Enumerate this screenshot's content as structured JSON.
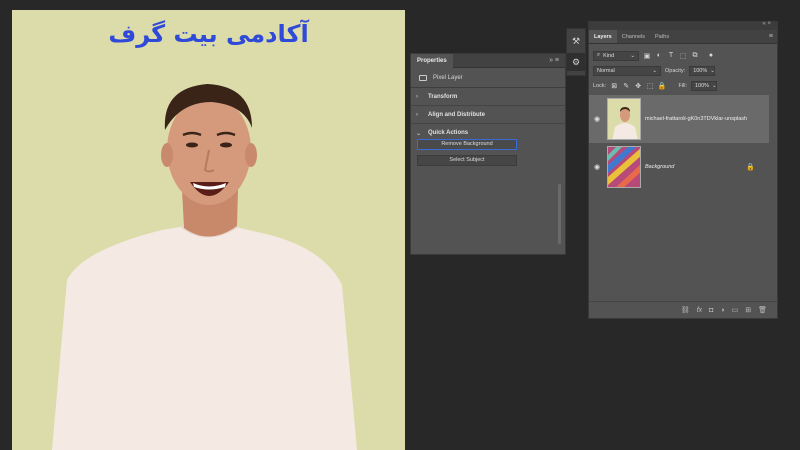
{
  "canvas": {
    "brand_text": "آکادمی بیت گرف"
  },
  "tools": {
    "items": [
      {
        "icon": "history-brush-icon",
        "glyph": "⚒"
      },
      {
        "icon": "properties-icon",
        "glyph": "⚙"
      }
    ]
  },
  "properties": {
    "tab_label": "Properties",
    "controls": "» ≡",
    "layer_type": "Pixel Layer",
    "sections": {
      "transform": "Transform",
      "align": "Align and Distribute",
      "quick_actions": "Quick Actions"
    },
    "buttons": {
      "remove_bg": "Remove Background",
      "select_subject": "Select Subject"
    }
  },
  "layers": {
    "tabs": [
      "Layers",
      "Channels",
      "Paths"
    ],
    "window_controls": "« ×",
    "filter": {
      "label": "Kind",
      "icons": [
        "image-filter-icon",
        "adjustment-filter-icon",
        "type-filter-icon",
        "shape-filter-icon",
        "smartobject-filter-icon"
      ]
    },
    "blend_mode": "Normal",
    "opacity_label": "Opacity:",
    "opacity_value": "100%",
    "lock_label": "Lock:",
    "fill_label": "Fill:",
    "fill_value": "100%",
    "items": [
      {
        "name": "michael-frattaroli-gK0n3TDVklar-unsplash",
        "selected": true,
        "visible": true
      },
      {
        "name": "Background",
        "selected": false,
        "visible": true,
        "locked": true
      }
    ],
    "footer_icons": [
      "link-icon",
      "fx-icon",
      "mask-icon",
      "adjustment-icon",
      "group-icon",
      "new-layer-icon",
      "trash-icon"
    ]
  },
  "colors": {
    "canvas_bg": "#dcdcaa",
    "brand_blue": "#2f49d8",
    "panel_bg": "#535353",
    "app_bg": "#282828",
    "highlight_blue": "#3a6ad6"
  }
}
